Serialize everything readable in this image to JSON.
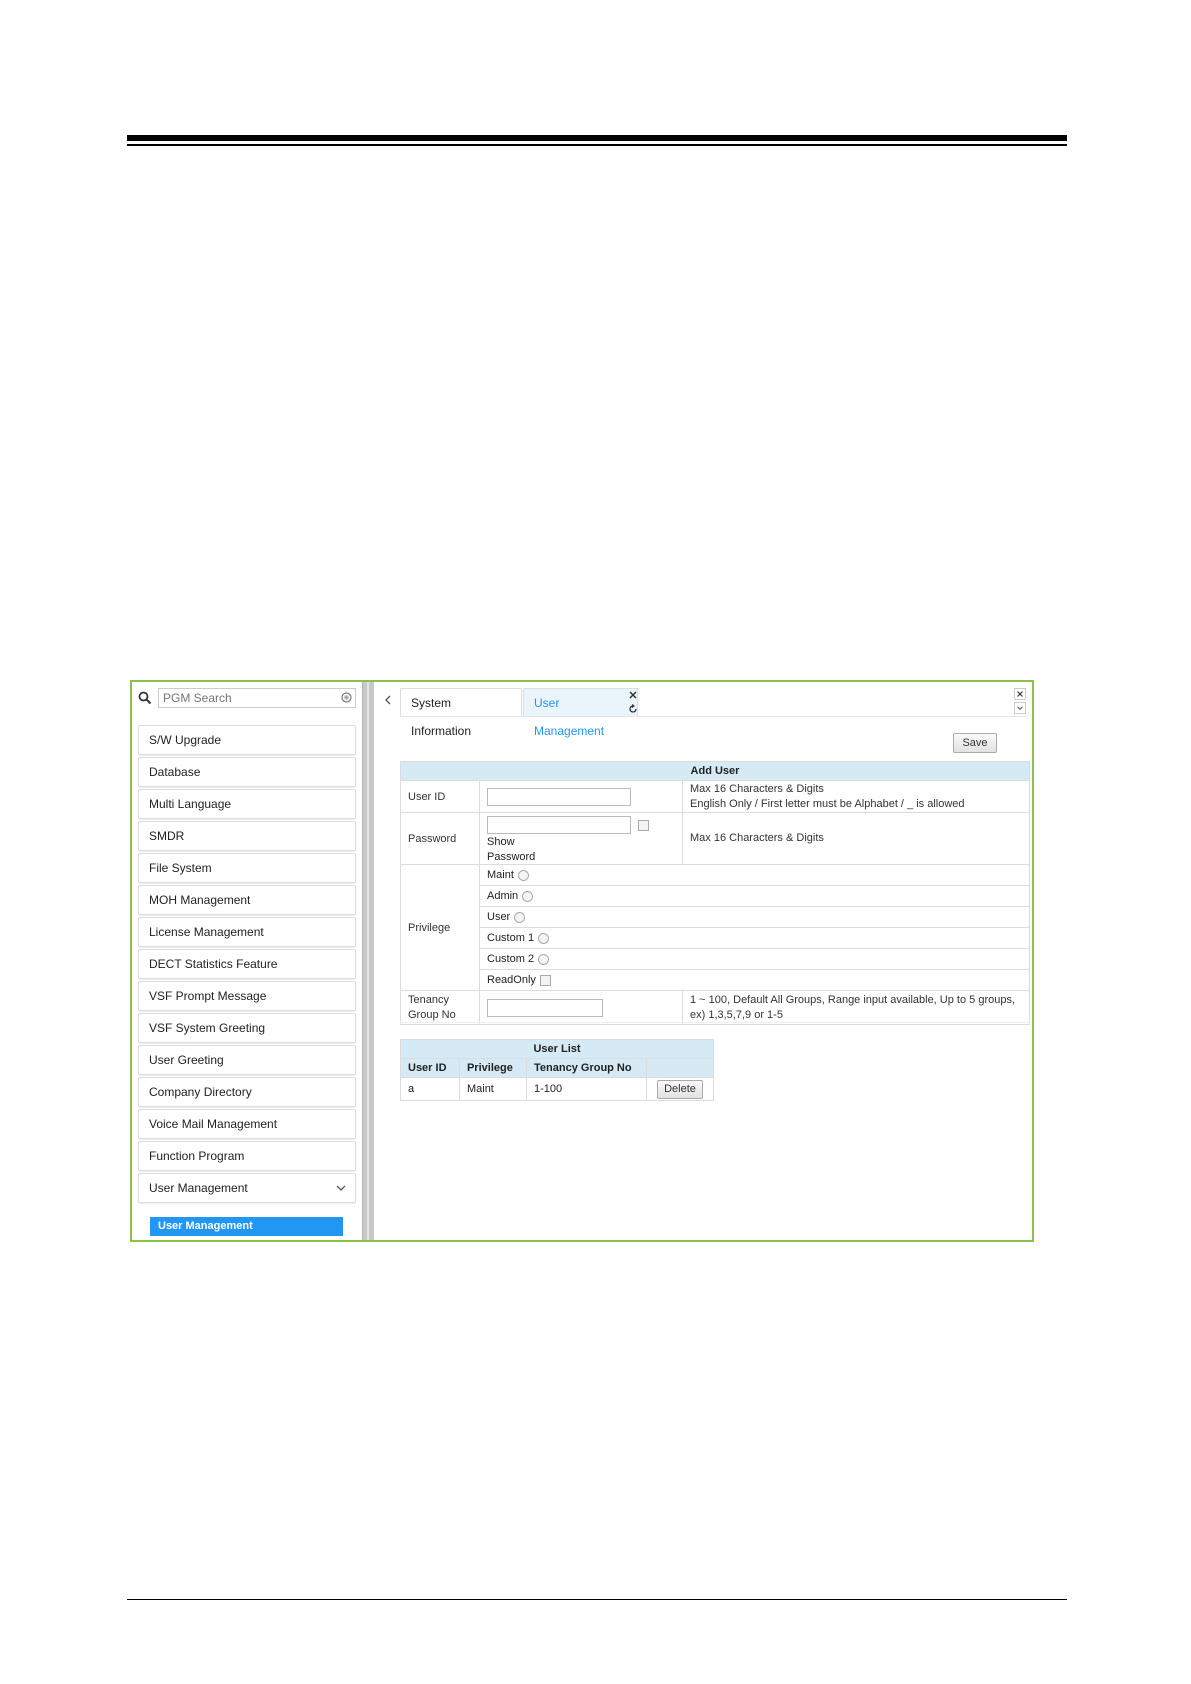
{
  "search": {
    "placeholder": "PGM Search"
  },
  "sidebar": {
    "items": [
      {
        "label": "S/W Upgrade"
      },
      {
        "label": "Database"
      },
      {
        "label": "Multi Language"
      },
      {
        "label": "SMDR"
      },
      {
        "label": "File System"
      },
      {
        "label": "MOH Management"
      },
      {
        "label": "License Management"
      },
      {
        "label": "DECT Statistics Feature"
      },
      {
        "label": "VSF Prompt Message"
      },
      {
        "label": "VSF System Greeting"
      },
      {
        "label": "User Greeting"
      },
      {
        "label": "Company Directory"
      },
      {
        "label": "Voice Mail Management"
      },
      {
        "label": "Function Program"
      },
      {
        "label": "User Management"
      }
    ],
    "sub_item": "User Management"
  },
  "tabs": [
    {
      "label": "System Information"
    },
    {
      "label": "User Management"
    }
  ],
  "toolbar": {
    "save_label": "Save"
  },
  "add_user": {
    "title": "Add User",
    "user_id_label": "User ID",
    "user_id_note_1": "Max 16 Characters & Digits",
    "user_id_note_2": "English Only / First letter must be Alphabet / _ is allowed",
    "password_label": "Password",
    "show_label": "Show",
    "password_sub": "Password",
    "password_note": "Max 16 Characters & Digits",
    "privilege_label": "Privilege",
    "privileges": [
      "Maint",
      "Admin",
      "User",
      "Custom 1",
      "Custom 2",
      "ReadOnly"
    ],
    "tenancy_label_1": "Tenancy",
    "tenancy_label_2": "Group No",
    "tenancy_note_1": "1 ~ 100, Default All Groups, Range input available, Up to 5 groups,",
    "tenancy_note_2": "ex) 1,3,5,7,9 or 1-5"
  },
  "user_list": {
    "title": "User List",
    "columns": [
      "User ID",
      "Privilege",
      "Tenancy Group No"
    ],
    "rows": [
      {
        "user_id": "a",
        "privilege": "Maint",
        "tenancy": "1-100",
        "action": "Delete"
      }
    ]
  }
}
